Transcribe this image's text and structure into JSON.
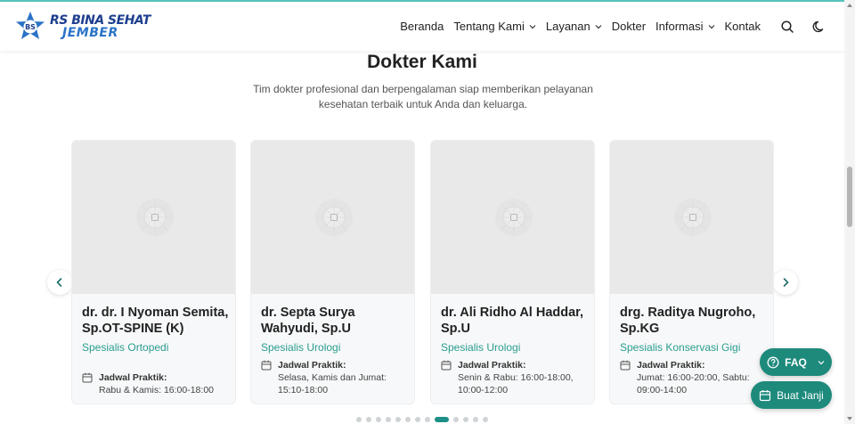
{
  "header": {
    "logo_line1": "RS BINA SEHAT",
    "logo_line2": "JEMBER",
    "nav": [
      {
        "label": "Beranda",
        "dropdown": false
      },
      {
        "label": "Tentang Kami",
        "dropdown": true
      },
      {
        "label": "Layanan",
        "dropdown": true
      },
      {
        "label": "Dokter",
        "dropdown": false
      },
      {
        "label": "Informasi",
        "dropdown": true
      },
      {
        "label": "Kontak",
        "dropdown": false
      }
    ],
    "icons": [
      "search-icon",
      "moon-icon"
    ]
  },
  "section": {
    "title": "Dokter Kami",
    "subtitle": "Tim dokter profesional dan berpengalaman siap memberikan pelayanan kesehatan terbaik untuk Anda dan keluarga."
  },
  "doctors": [
    {
      "name": "dr. dr. I Nyoman Semita, Sp.OT-SPINE (K)",
      "specialty": "Spesialis Ortopedi",
      "schedule_label": "Jadwal Praktik:",
      "schedule": "Rabu & Kamis: 16:00-18:00"
    },
    {
      "name": "dr. Septa Surya Wahyudi, Sp.U",
      "specialty": "Spesialis Urologi",
      "schedule_label": "Jadwal Praktik:",
      "schedule": "Selasa, Kamis dan Jumat: 15:10-18:00"
    },
    {
      "name": "dr. Ali Ridho Al Haddar, Sp.U",
      "specialty": "Spesialis Urologi",
      "schedule_label": "Jadwal Praktik:",
      "schedule": "Senin & Rabu: 16:00-18:00, 10:00-12:00"
    },
    {
      "name": "drg. Raditya Nugroho, Sp.KG",
      "specialty": "Spesialis Konservasi Gigi",
      "schedule_label": "Jadwal Praktik:",
      "schedule": "Jumat: 16:00-20:00, Sabtu: 09:00-14:00"
    }
  ],
  "carousel": {
    "dot_count": 13,
    "active_dot": 8
  },
  "floating": {
    "faq_label": "FAQ",
    "appointment_label": "Buat Janji"
  },
  "colors": {
    "accent": "#1e8a7c",
    "specialty": "#2a9d8f",
    "logo_navy": "#1e3f8f",
    "logo_blue": "#2a73c7"
  }
}
